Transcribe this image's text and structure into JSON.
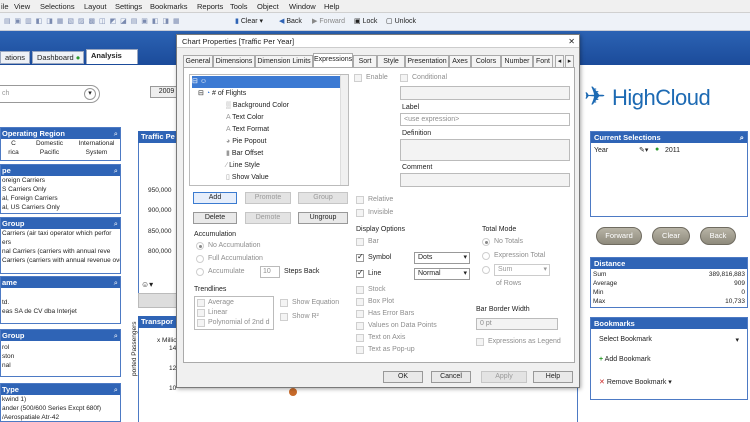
{
  "menu": [
    "ile",
    "View",
    "Selections",
    "Layout",
    "Settings",
    "Bookmarks",
    "Reports",
    "Tools",
    "Object",
    "Window",
    "Help"
  ],
  "toolbar": {
    "clear": "Clear",
    "back": "Back",
    "forward": "Forward",
    "lock": "Lock",
    "unlock": "Unlock"
  },
  "tabs": {
    "t1": "ations",
    "t2": "Dashboard",
    "t3": "Analysis"
  },
  "search": {
    "placeholder": "ch"
  },
  "year_button": "2009",
  "left_panels": {
    "region": {
      "title": "Operating Region",
      "cols": [
        "C",
        "Domestic",
        "International"
      ],
      "cols2": [
        "rica",
        "Pacific",
        "System"
      ]
    },
    "type": {
      "title": "pe",
      "rows": [
        "oreign Carriers",
        "S Carriers Only",
        "al, Foreign Carriers",
        "al, US Carriers Only"
      ]
    },
    "group": {
      "title": "Group",
      "rows": [
        "Carriers (air taxi operator which perfor",
        "ers",
        "nal Carriers (carriers with annual reve",
        "Carriers (carriers with annual revenue over"
      ]
    },
    "name": {
      "title": "ame",
      "rows": [
        "td.",
        "eas SA de CV dba Interjet"
      ]
    },
    "group2": {
      "title": "Group",
      "rows": [
        "rol",
        "ston",
        "nal"
      ]
    },
    "type2": {
      "title": "Type",
      "rows": [
        "kwind 1)",
        "ander (500/600 Series Excpt 680f)",
        "/Aerospatiale Atr-42"
      ]
    }
  },
  "chart_area": {
    "title": "Traffic Pe",
    "yticks": [
      "950,000",
      "900,000",
      "850,000",
      "800,000"
    ],
    "transport_title": "Transpor",
    "milli": "x Millio",
    "y14": "14",
    "y12": "12",
    "y10": "10",
    "passengers": "ported Passengers"
  },
  "logo": {
    "text": "HighCloud",
    "color": "#1d6ab3"
  },
  "current_selections": {
    "title": "Current Selections",
    "field": "Year",
    "value": "2011"
  },
  "buttons": {
    "forward": "Forward",
    "clear": "Clear",
    "back": "Back"
  },
  "distance": {
    "title": "Distance",
    "rows": [
      [
        "Sum",
        "389,816,883"
      ],
      [
        "Average",
        "909"
      ],
      [
        "Min",
        "0"
      ],
      [
        "Max",
        "10,733"
      ]
    ]
  },
  "bookmarks": {
    "title": "Bookmarks",
    "select": "Select Bookmark",
    "add": "Add Bookmark",
    "remove": "Remove Bookmark"
  },
  "dialog": {
    "title": "Chart Properties [Traffic Per Year]",
    "tabs": [
      "General",
      "Dimensions",
      "Dimension Limits",
      "Expressions",
      "Sort",
      "Style",
      "Presentation",
      "Axes",
      "Colors",
      "Number",
      "Font"
    ],
    "tree": [
      "# of Flights",
      "Background Color",
      "Text Color",
      "Text Format",
      "Pie Popout",
      "Bar Offset",
      "Line Style",
      "Show Value"
    ],
    "enable": "Enable",
    "conditional": "Conditional",
    "label": "Label",
    "label_placeholder": "<use expression>",
    "definition": "Definition",
    "comment": "Comment",
    "add": "Add",
    "promote": "Promote",
    "group": "Group",
    "delete": "Delete",
    "demote": "Demote",
    "ungroup": "Ungroup",
    "relative": "Relative",
    "invisible": "Invisible",
    "accumulation": {
      "title": "Accumulation",
      "no": "No Accumulation",
      "full": "Full Accumulation",
      "acc": "Accumulate",
      "steps_value": "10",
      "steps": "Steps Back"
    },
    "trendlines": {
      "title": "Trendlines",
      "items": [
        "Average",
        "Linear",
        "Polynomial of 2nd d"
      ],
      "show_eq": "Show Equation",
      "show_r": "Show R²"
    },
    "display": {
      "title": "Display Options",
      "bar": "Bar",
      "symbol": "Symbol",
      "symbol_sel": "Dots",
      "line": "Line",
      "line_sel": "Normal",
      "stock": "Stock",
      "boxplot": "Box Plot",
      "errbars": "Has Error Bars",
      "values": "Values on Data Points",
      "textaxis": "Text on Axis",
      "popup": "Text as Pop-up"
    },
    "total": {
      "title": "Total Mode",
      "no": "No Totals",
      "expr": "Expression Total",
      "sum": "Sum",
      "of_rows": "of Rows"
    },
    "bar_border": {
      "title": "Bar Border Width",
      "value": "0 pt"
    },
    "expr_legend": "Expressions as Legend",
    "ok": "OK",
    "cancel": "Cancel",
    "apply": "Apply",
    "help": "Help"
  }
}
